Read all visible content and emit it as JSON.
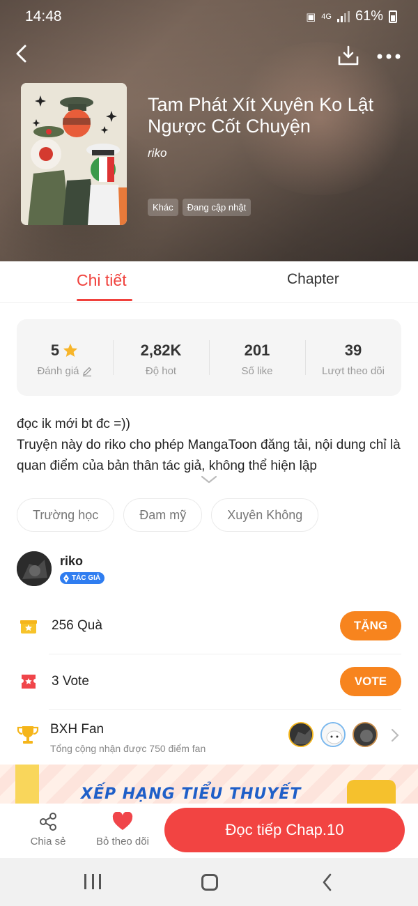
{
  "status_bar": {
    "time": "14:48",
    "network": "4G",
    "battery": "61%"
  },
  "header": {
    "title": "Tam Phát Xít Xuyên Ko Lật Ngược Cốt Chuyện",
    "author": "riko",
    "tags": [
      "Khác",
      "Đang cập nhật"
    ]
  },
  "tabs": {
    "detail": "Chi tiết",
    "chapter": "Chapter",
    "active": "detail"
  },
  "stats": {
    "rating": {
      "value": "5",
      "label": "Đánh giá"
    },
    "hot": {
      "value": "2,82K",
      "label": "Độ hot"
    },
    "likes": {
      "value": "201",
      "label": "Số like"
    },
    "follows": {
      "value": "39",
      "label": "Lượt theo dõi"
    }
  },
  "description": {
    "line1": "đọc ik mới bt đc =))",
    "line2": "Truyện này do riko cho phép MangaToon đăng tải, nội dung chỉ là quan điểm của bản thân tác giả, không thể hiện lập"
  },
  "genres": [
    "Trường học",
    "Đam mỹ",
    "Xuyên Không"
  ],
  "author_block": {
    "name": "riko",
    "badge": "TÁC GIẢ"
  },
  "gifts": {
    "count": "256",
    "label": "Quà",
    "button": "TẶNG"
  },
  "votes": {
    "count": "3",
    "label": "Vote",
    "button": "VOTE"
  },
  "fan_rank": {
    "title": "BXH Fan",
    "subtitle": "Tổng cộng nhận được 750 điểm fan"
  },
  "banner": {
    "text": "XẾP HẠNG TIỂU THUYẾT"
  },
  "bottom_bar": {
    "share": "Chia sẻ",
    "unfollow": "Bỏ theo dõi",
    "read_button": "Đọc tiếp Chap.10"
  },
  "colors": {
    "accent": "#f0413c",
    "orange": "#f7841e",
    "read_button": "#f24442",
    "badge_blue": "#2f7df0"
  }
}
